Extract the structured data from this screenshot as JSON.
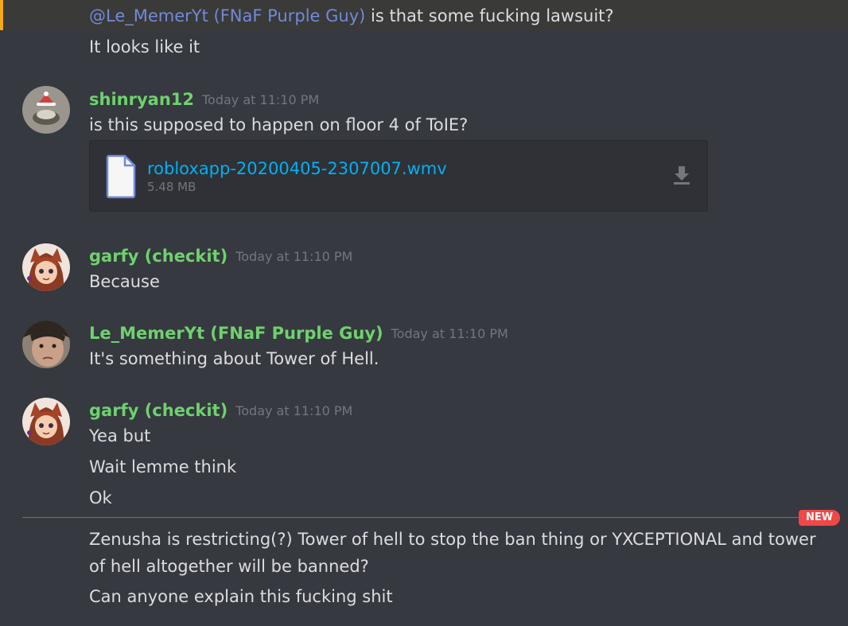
{
  "messages": {
    "reply_mention": "@Le_MemerYt (FNaF Purple Guy)",
    "reply_rest": " is that some fucking lawsuit?",
    "reply_followup": "It looks like it",
    "group1": {
      "username": "shinryan12",
      "timestamp": "Today at 11:10 PM",
      "text": "is this supposed to happen on floor 4 of ToIE?",
      "attachment": {
        "filename": "robloxapp-20200405-2307007.wmv",
        "size": "5.48 MB"
      }
    },
    "group2": {
      "username": "garfy (checkit)",
      "timestamp": "Today at 11:10 PM",
      "text": "Because"
    },
    "group3": {
      "username": "Le_MemerYt (FNaF Purple Guy)",
      "timestamp": "Today at 11:10 PM",
      "text": "It's something about Tower of Hell."
    },
    "group4": {
      "username": "garfy (checkit)",
      "timestamp": "Today at 11:10 PM",
      "lines": [
        "Yea but",
        "Wait lemme think",
        "Ok"
      ],
      "after_divider": [
        "Zenusha is restricting(?) Tower of hell to stop the ban thing or YXCEPTIONAL and tower",
        "of hell altogether will be banned?",
        "Can anyone explain this fucking shit"
      ]
    }
  },
  "new_badge": "NEW",
  "colors": {
    "background": "#36393f",
    "username": "#6fd16f",
    "mention": "#7289da",
    "link": "#00b0f4",
    "new": "#f04747",
    "mention_highlight_bar": "#faa81a"
  },
  "icons": {
    "file": "file-icon",
    "download": "download-icon"
  }
}
